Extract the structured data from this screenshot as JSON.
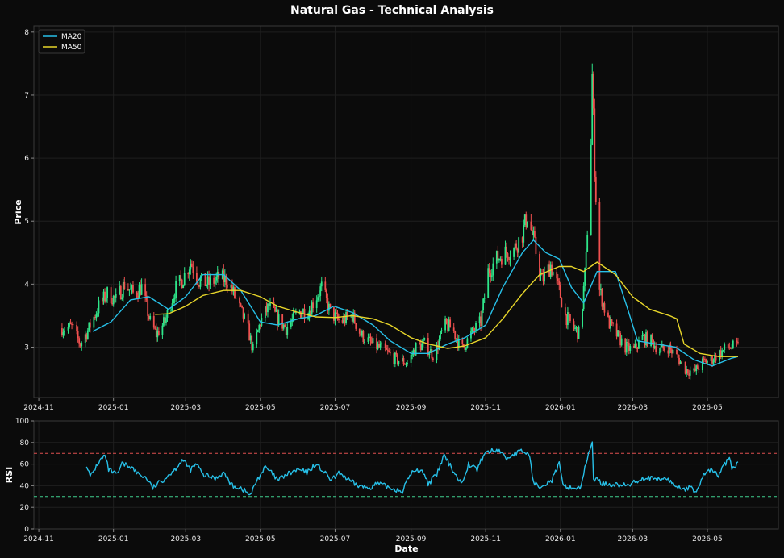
{
  "title": "Natural Gas - Technical Analysis",
  "colors": {
    "background": "#0b0b0b",
    "panel_border": "#3a3a3a",
    "grid": "#1f1f1f",
    "up": "#2ee68a",
    "down": "#f0504f",
    "ma20": "#27c0e8",
    "ma50": "#e8d62a",
    "rsi": "#27c0e8",
    "overbought": "#e05050",
    "oversold": "#3fcf8e"
  },
  "chart_data": [
    {
      "type": "candlestick",
      "ylabel": "Price",
      "ylim": [
        2.2,
        8.1
      ],
      "yticks": [
        3,
        4,
        5,
        6,
        7,
        8
      ],
      "xlim": [
        "2024-10-28",
        "2026-06-28"
      ],
      "xticks": [
        "2024-11",
        "2025-01",
        "2025-03",
        "2025-05",
        "2025-07",
        "2025-09",
        "2025-11",
        "2026-01",
        "2026-03",
        "2026-05"
      ],
      "legend": {
        "position": "upper left",
        "entries": [
          "MA20",
          "MA50"
        ]
      },
      "grid": true,
      "price_anchors": [
        [
          "2024-11-20",
          3.3
        ],
        [
          "2024-11-28",
          3.32
        ],
        [
          "2024-12-05",
          3.05
        ],
        [
          "2024-12-12",
          3.3
        ],
        [
          "2024-12-20",
          3.65
        ],
        [
          "2024-12-27",
          3.85
        ],
        [
          "2025-01-03",
          3.75
        ],
        [
          "2025-01-10",
          4.0
        ],
        [
          "2025-01-17",
          3.85
        ],
        [
          "2025-01-24",
          3.95
        ],
        [
          "2025-01-31",
          3.4
        ],
        [
          "2025-02-05",
          3.2
        ],
        [
          "2025-02-12",
          3.4
        ],
        [
          "2025-02-20",
          3.9
        ],
        [
          "2025-02-27",
          4.1
        ],
        [
          "2025-03-05",
          4.35
        ],
        [
          "2025-03-12",
          4.05
        ],
        [
          "2025-03-20",
          4.0
        ],
        [
          "2025-03-28",
          4.1
        ],
        [
          "2025-04-05",
          4.05
        ],
        [
          "2025-04-12",
          3.7
        ],
        [
          "2025-04-20",
          3.35
        ],
        [
          "2025-04-25",
          2.95
        ],
        [
          "2025-05-01",
          3.4
        ],
        [
          "2025-05-08",
          3.65
        ],
        [
          "2025-05-15",
          3.45
        ],
        [
          "2025-05-22",
          3.3
        ],
        [
          "2025-06-01",
          3.55
        ],
        [
          "2025-06-10",
          3.6
        ],
        [
          "2025-06-20",
          3.95
        ],
        [
          "2025-06-27",
          3.55
        ],
        [
          "2025-07-05",
          3.4
        ],
        [
          "2025-07-15",
          3.5
        ],
        [
          "2025-07-22",
          3.2
        ],
        [
          "2025-07-31",
          3.05
        ],
        [
          "2025-08-10",
          2.95
        ],
        [
          "2025-08-20",
          2.8
        ],
        [
          "2025-08-29",
          2.75
        ],
        [
          "2025-09-05",
          3.0
        ],
        [
          "2025-09-12",
          3.05
        ],
        [
          "2025-09-20",
          2.85
        ],
        [
          "2025-09-28",
          3.35
        ],
        [
          "2025-10-05",
          3.3
        ],
        [
          "2025-10-12",
          2.95
        ],
        [
          "2025-10-20",
          3.2
        ],
        [
          "2025-10-28",
          3.4
        ],
        [
          "2025-11-03",
          4.2
        ],
        [
          "2025-11-10",
          4.4
        ],
        [
          "2025-11-17",
          4.5
        ],
        [
          "2025-11-24",
          4.55
        ],
        [
          "2025-12-01",
          4.8
        ],
        [
          "2025-12-05",
          5.1
        ],
        [
          "2025-12-10",
          4.7
        ],
        [
          "2025-12-17",
          4.05
        ],
        [
          "2025-12-24",
          4.3
        ],
        [
          "2025-12-31",
          3.9
        ],
        [
          "2026-01-05",
          3.5
        ],
        [
          "2026-01-12",
          3.3
        ],
        [
          "2026-01-17",
          3.2
        ],
        [
          "2026-01-22",
          4.4
        ],
        [
          "2026-01-26",
          6.3
        ],
        [
          "2026-01-27",
          7.3
        ],
        [
          "2026-01-29",
          5.9
        ],
        [
          "2026-02-02",
          3.9
        ],
        [
          "2026-02-09",
          3.4
        ],
        [
          "2026-02-16",
          3.2
        ],
        [
          "2026-02-23",
          3.0
        ],
        [
          "2026-03-02",
          2.95
        ],
        [
          "2026-03-09",
          3.15
        ],
        [
          "2026-03-16",
          3.1
        ],
        [
          "2026-03-23",
          2.95
        ],
        [
          "2026-03-30",
          3.0
        ],
        [
          "2026-04-06",
          2.85
        ],
        [
          "2026-04-13",
          2.65
        ],
        [
          "2026-04-20",
          2.6
        ],
        [
          "2026-04-27",
          2.75
        ],
        [
          "2026-05-04",
          2.8
        ],
        [
          "2026-05-11",
          2.9
        ],
        [
          "2026-05-18",
          3.0
        ],
        [
          "2026-05-26",
          3.0
        ]
      ],
      "series": [
        {
          "name": "MA20",
          "points": [
            [
              "2024-12-15",
              3.25
            ],
            [
              "2024-12-30",
              3.4
            ],
            [
              "2025-01-15",
              3.75
            ],
            [
              "2025-01-30",
              3.8
            ],
            [
              "2025-02-15",
              3.6
            ],
            [
              "2025-03-01",
              3.8
            ],
            [
              "2025-03-15",
              4.15
            ],
            [
              "2025-04-01",
              4.15
            ],
            [
              "2025-04-15",
              3.9
            ],
            [
              "2025-05-01",
              3.4
            ],
            [
              "2025-05-15",
              3.35
            ],
            [
              "2025-06-01",
              3.45
            ],
            [
              "2025-06-15",
              3.5
            ],
            [
              "2025-06-30",
              3.65
            ],
            [
              "2025-07-15",
              3.55
            ],
            [
              "2025-08-01",
              3.35
            ],
            [
              "2025-08-15",
              3.1
            ],
            [
              "2025-09-01",
              2.9
            ],
            [
              "2025-09-15",
              2.9
            ],
            [
              "2025-10-01",
              3.05
            ],
            [
              "2025-10-15",
              3.15
            ],
            [
              "2025-11-01",
              3.35
            ],
            [
              "2025-11-15",
              3.95
            ],
            [
              "2025-12-01",
              4.5
            ],
            [
              "2025-12-10",
              4.7
            ],
            [
              "2025-12-20",
              4.5
            ],
            [
              "2025-12-31",
              4.4
            ],
            [
              "2026-01-10",
              3.95
            ],
            [
              "2026-01-20",
              3.7
            ],
            [
              "2026-01-31",
              4.2
            ],
            [
              "2026-02-15",
              4.2
            ],
            [
              "2026-02-25",
              3.6
            ],
            [
              "2026-03-05",
              3.1
            ],
            [
              "2026-03-20",
              3.05
            ],
            [
              "2026-04-05",
              3.0
            ],
            [
              "2026-04-20",
              2.8
            ],
            [
              "2026-05-05",
              2.7
            ],
            [
              "2026-05-20",
              2.82
            ],
            [
              "2026-05-26",
              2.85
            ]
          ]
        },
        {
          "name": "MA50",
          "points": [
            [
              "2025-02-04",
              3.52
            ],
            [
              "2025-02-15",
              3.53
            ],
            [
              "2025-03-01",
              3.65
            ],
            [
              "2025-03-15",
              3.82
            ],
            [
              "2025-04-01",
              3.9
            ],
            [
              "2025-04-15",
              3.9
            ],
            [
              "2025-05-01",
              3.8
            ],
            [
              "2025-05-15",
              3.65
            ],
            [
              "2025-06-01",
              3.55
            ],
            [
              "2025-06-15",
              3.48
            ],
            [
              "2025-07-01",
              3.47
            ],
            [
              "2025-07-15",
              3.5
            ],
            [
              "2025-08-01",
              3.45
            ],
            [
              "2025-08-15",
              3.35
            ],
            [
              "2025-09-01",
              3.15
            ],
            [
              "2025-09-15",
              3.05
            ],
            [
              "2025-10-01",
              2.98
            ],
            [
              "2025-10-15",
              3.02
            ],
            [
              "2025-11-01",
              3.15
            ],
            [
              "2025-11-15",
              3.45
            ],
            [
              "2025-12-01",
              3.85
            ],
            [
              "2025-12-15",
              4.15
            ],
            [
              "2025-12-31",
              4.28
            ],
            [
              "2026-01-10",
              4.28
            ],
            [
              "2026-01-20",
              4.2
            ],
            [
              "2026-01-31",
              4.35
            ],
            [
              "2026-02-15",
              4.15
            ],
            [
              "2026-03-01",
              3.8
            ],
            [
              "2026-03-15",
              3.6
            ],
            [
              "2026-03-31",
              3.5
            ],
            [
              "2026-04-06",
              3.45
            ],
            [
              "2026-04-12",
              3.05
            ],
            [
              "2026-04-25",
              2.9
            ],
            [
              "2026-05-10",
              2.85
            ],
            [
              "2026-05-26",
              2.85
            ]
          ]
        }
      ]
    },
    {
      "type": "line",
      "xlabel": "Date",
      "ylabel": "RSI",
      "ylim": [
        0,
        100
      ],
      "yticks": [
        0,
        20,
        40,
        60,
        80,
        100
      ],
      "xlim": [
        "2024-10-28",
        "2026-06-28"
      ],
      "xticks": [
        "2024-11",
        "2025-01",
        "2025-03",
        "2025-05",
        "2025-07",
        "2025-09",
        "2025-11",
        "2026-01",
        "2026-03",
        "2026-05"
      ],
      "grid": true,
      "thresholds": [
        {
          "value": 70,
          "style": "dashed",
          "color_key": "overbought"
        },
        {
          "value": 30,
          "style": "dashed",
          "color_key": "oversold"
        }
      ],
      "series": [
        {
          "name": "RSI",
          "points": [
            [
              "2024-12-10",
              60
            ],
            [
              "2024-12-13",
              48
            ],
            [
              "2024-12-20",
              62
            ],
            [
              "2024-12-25",
              68
            ],
            [
              "2024-12-28",
              55
            ],
            [
              "2025-01-04",
              50
            ],
            [
              "2025-01-08",
              60
            ],
            [
              "2025-01-15",
              58
            ],
            [
              "2025-01-20",
              52
            ],
            [
              "2025-01-28",
              47
            ],
            [
              "2025-02-02",
              38
            ],
            [
              "2025-02-10",
              45
            ],
            [
              "2025-02-20",
              55
            ],
            [
              "2025-02-26",
              64
            ],
            [
              "2025-03-05",
              55
            ],
            [
              "2025-03-10",
              60
            ],
            [
              "2025-03-15",
              50
            ],
            [
              "2025-03-25",
              47
            ],
            [
              "2025-04-01",
              52
            ],
            [
              "2025-04-08",
              40
            ],
            [
              "2025-04-15",
              38
            ],
            [
              "2025-04-23",
              31
            ],
            [
              "2025-04-28",
              45
            ],
            [
              "2025-05-05",
              57
            ],
            [
              "2025-05-10",
              52
            ],
            [
              "2025-05-15",
              45
            ],
            [
              "2025-05-22",
              50
            ],
            [
              "2025-06-01",
              55
            ],
            [
              "2025-06-08",
              52
            ],
            [
              "2025-06-15",
              60
            ],
            [
              "2025-06-20",
              55
            ],
            [
              "2025-06-28",
              45
            ],
            [
              "2025-07-05",
              52
            ],
            [
              "2025-07-12",
              45
            ],
            [
              "2025-07-20",
              40
            ],
            [
              "2025-07-28",
              38
            ],
            [
              "2025-08-05",
              42
            ],
            [
              "2025-08-15",
              38
            ],
            [
              "2025-08-25",
              35
            ],
            [
              "2025-09-01",
              52
            ],
            [
              "2025-09-10",
              55
            ],
            [
              "2025-09-15",
              42
            ],
            [
              "2025-09-22",
              50
            ],
            [
              "2025-09-28",
              68
            ],
            [
              "2025-10-05",
              55
            ],
            [
              "2025-10-12",
              42
            ],
            [
              "2025-10-18",
              60
            ],
            [
              "2025-10-25",
              55
            ],
            [
              "2025-10-31",
              70
            ],
            [
              "2025-11-05",
              72
            ],
            [
              "2025-11-12",
              73
            ],
            [
              "2025-11-18",
              65
            ],
            [
              "2025-11-25",
              70
            ],
            [
              "2025-12-01",
              72
            ],
            [
              "2025-12-07",
              68
            ],
            [
              "2025-12-10",
              42
            ],
            [
              "2025-12-15",
              40
            ],
            [
              "2025-12-25",
              45
            ],
            [
              "2025-12-31",
              60
            ],
            [
              "2026-01-03",
              40
            ],
            [
              "2026-01-10",
              38
            ],
            [
              "2026-01-17",
              38
            ],
            [
              "2026-01-22",
              60
            ],
            [
              "2026-01-27",
              82
            ],
            [
              "2026-01-28",
              47
            ],
            [
              "2026-02-05",
              42
            ],
            [
              "2026-02-15",
              41
            ],
            [
              "2026-02-25",
              40
            ],
            [
              "2026-03-05",
              45
            ],
            [
              "2026-03-12",
              48
            ],
            [
              "2026-03-20",
              45
            ],
            [
              "2026-03-28",
              47
            ],
            [
              "2026-04-05",
              40
            ],
            [
              "2026-04-12",
              37
            ],
            [
              "2026-04-18",
              38
            ],
            [
              "2026-04-22",
              34
            ],
            [
              "2026-04-28",
              50
            ],
            [
              "2026-05-03",
              55
            ],
            [
              "2026-05-10",
              50
            ],
            [
              "2026-05-17",
              63
            ],
            [
              "2026-05-19",
              66
            ],
            [
              "2026-05-21",
              55
            ],
            [
              "2026-05-26",
              60
            ]
          ]
        }
      ]
    }
  ]
}
